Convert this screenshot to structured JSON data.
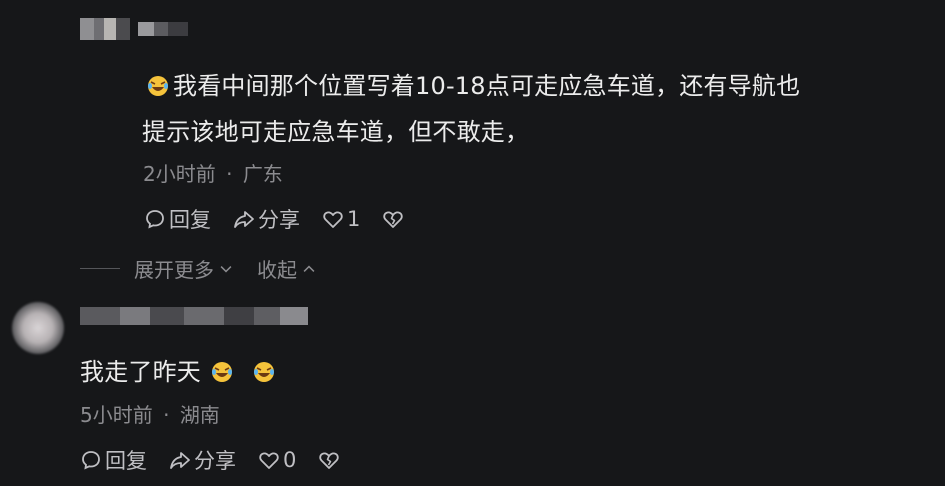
{
  "reply": {
    "text_line1": "我看中间那个位置写着10-18点可走应急车道，还有导航也",
    "text_line2": "提示该地可走应急车道，但不敢走，",
    "time": "2小时前",
    "separator": "·",
    "location": "广东",
    "reply_label": "回复",
    "share_label": "分享",
    "like_count": "1",
    "emoji_icon": "laughing-crying-emoji"
  },
  "thread_controls": {
    "expand_label": "展开更多",
    "collapse_label": "收起"
  },
  "comment": {
    "text": "我走了昨天",
    "time": "5小时前",
    "separator": "·",
    "location": "湖南",
    "reply_label": "回复",
    "share_label": "分享",
    "like_count": "0",
    "emoji_icon": "laughing-crying-emoji"
  },
  "colors": {
    "background": "#161719",
    "text": "#ececec",
    "meta": "#8b8b8f"
  }
}
